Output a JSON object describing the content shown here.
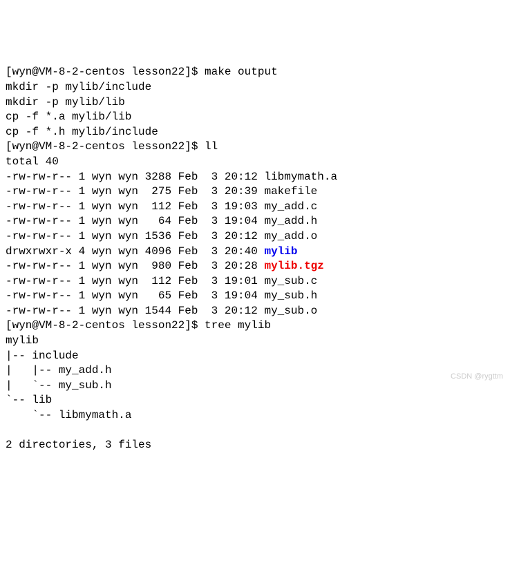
{
  "prompt1": "[wyn@VM-8-2-centos lesson22]$ ",
  "cmd1": "make output",
  "out1": "mkdir -p mylib/include",
  "out2": "mkdir -p mylib/lib",
  "out3": "cp -f *.a mylib/lib",
  "out4": "cp -f *.h mylib/include",
  "prompt2": "[wyn@VM-8-2-centos lesson22]$ ",
  "cmd2": "ll",
  "total": "total 40",
  "files": [
    {
      "perm": "-rw-rw-r--",
      "links": "1",
      "user": "wyn",
      "group": "wyn",
      "size": "3288",
      "month": "Feb",
      "day": " 3",
      "time": "20:12",
      "name": "libmymath.a",
      "cls": ""
    },
    {
      "perm": "-rw-rw-r--",
      "links": "1",
      "user": "wyn",
      "group": "wyn",
      "size": " 275",
      "month": "Feb",
      "day": " 3",
      "time": "20:39",
      "name": "makefile",
      "cls": ""
    },
    {
      "perm": "-rw-rw-r--",
      "links": "1",
      "user": "wyn",
      "group": "wyn",
      "size": " 112",
      "month": "Feb",
      "day": " 3",
      "time": "19:03",
      "name": "my_add.c",
      "cls": ""
    },
    {
      "perm": "-rw-rw-r--",
      "links": "1",
      "user": "wyn",
      "group": "wyn",
      "size": "  64",
      "month": "Feb",
      "day": " 3",
      "time": "19:04",
      "name": "my_add.h",
      "cls": ""
    },
    {
      "perm": "-rw-rw-r--",
      "links": "1",
      "user": "wyn",
      "group": "wyn",
      "size": "1536",
      "month": "Feb",
      "day": " 3",
      "time": "20:12",
      "name": "my_add.o",
      "cls": ""
    },
    {
      "perm": "drwxrwxr-x",
      "links": "4",
      "user": "wyn",
      "group": "wyn",
      "size": "4096",
      "month": "Feb",
      "day": " 3",
      "time": "20:40",
      "name": "mylib",
      "cls": "blue"
    },
    {
      "perm": "-rw-rw-r--",
      "links": "1",
      "user": "wyn",
      "group": "wyn",
      "size": " 980",
      "month": "Feb",
      "day": " 3",
      "time": "20:28",
      "name": "mylib.tgz",
      "cls": "red"
    },
    {
      "perm": "-rw-rw-r--",
      "links": "1",
      "user": "wyn",
      "group": "wyn",
      "size": " 112",
      "month": "Feb",
      "day": " 3",
      "time": "19:01",
      "name": "my_sub.c",
      "cls": ""
    },
    {
      "perm": "-rw-rw-r--",
      "links": "1",
      "user": "wyn",
      "group": "wyn",
      "size": "  65",
      "month": "Feb",
      "day": " 3",
      "time": "19:04",
      "name": "my_sub.h",
      "cls": ""
    },
    {
      "perm": "-rw-rw-r--",
      "links": "1",
      "user": "wyn",
      "group": "wyn",
      "size": "1544",
      "month": "Feb",
      "day": " 3",
      "time": "20:12",
      "name": "my_sub.o",
      "cls": ""
    }
  ],
  "prompt3": "[wyn@VM-8-2-centos lesson22]$ ",
  "cmd3": "tree mylib",
  "tree1": "mylib",
  "tree2": "|-- include",
  "tree3": "|   |-- my_add.h",
  "tree4": "|   `-- my_sub.h",
  "tree5": "`-- lib",
  "tree6": "    `-- libmymath.a",
  "summary": "2 directories, 3 files",
  "watermark": "CSDN @rygttm"
}
